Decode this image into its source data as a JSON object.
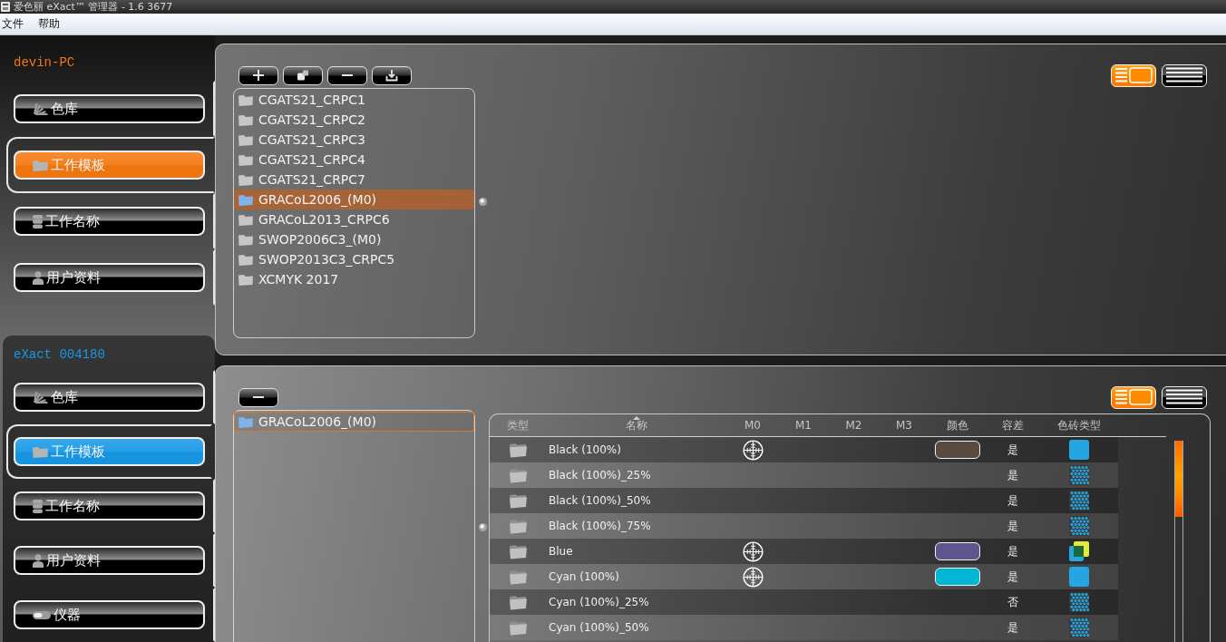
{
  "window": {
    "title": "爱色丽 eXact™ 管理器 - 1.6 3677"
  },
  "menu": [
    {
      "label": "文件"
    },
    {
      "label": "帮助"
    }
  ],
  "sidebar": {
    "sections": [
      {
        "label": "devin-PC",
        "color": "#f5780f",
        "items": [
          {
            "kind": "library",
            "label": "色库",
            "selected": false
          },
          {
            "kind": "template",
            "label": "工作模板",
            "selected": true
          },
          {
            "kind": "job",
            "label": "工作名称",
            "selected": false
          },
          {
            "kind": "user",
            "label": "用户资料",
            "selected": false
          }
        ]
      },
      {
        "label": "eXact 004180",
        "color": "#1799e6",
        "items": [
          {
            "kind": "library",
            "label": "色库",
            "selected": false
          },
          {
            "kind": "template",
            "label": "工作模板",
            "selected": true
          },
          {
            "kind": "job",
            "label": "工作名称",
            "selected": false
          },
          {
            "kind": "user",
            "label": "用户资料",
            "selected": false
          },
          {
            "kind": "instrument",
            "label": "仪器",
            "selected": false
          }
        ]
      }
    ]
  },
  "library_panel": {
    "toolbar": [
      {
        "kind": "add"
      },
      {
        "kind": "copy"
      },
      {
        "kind": "remove"
      },
      {
        "kind": "import"
      }
    ],
    "views": [
      {
        "kind": "split",
        "selected": true
      },
      {
        "kind": "list",
        "selected": false
      }
    ],
    "templates": [
      {
        "label": "CGATS21_CRPC1",
        "selected": false
      },
      {
        "label": "CGATS21_CRPC2",
        "selected": false
      },
      {
        "label": "CGATS21_CRPC3",
        "selected": false
      },
      {
        "label": "CGATS21_CRPC4",
        "selected": false
      },
      {
        "label": "CGATS21_CRPC7",
        "selected": false
      },
      {
        "label": "GRACoL2006_(M0)",
        "selected": true
      },
      {
        "label": "GRACoL2013_CRPC6",
        "selected": false
      },
      {
        "label": "SWOP2006C3_(M0)",
        "selected": false
      },
      {
        "label": "SWOP2013C3_CRPC5",
        "selected": false
      },
      {
        "label": "XCMYK 2017",
        "selected": false
      }
    ]
  },
  "detail_panel": {
    "toolbar": [
      {
        "kind": "remove"
      }
    ],
    "views": [
      {
        "kind": "split",
        "selected": true
      },
      {
        "kind": "list",
        "selected": false
      }
    ],
    "templates": [
      {
        "label": "GRACoL2006_(M0)",
        "selected": true
      }
    ],
    "table": {
      "columns": [
        {
          "label": "类型",
          "sorted": false
        },
        {
          "label": "名称",
          "sorted": true
        },
        {
          "label": "M0",
          "sorted": false
        },
        {
          "label": "M1",
          "sorted": false
        },
        {
          "label": "M2",
          "sorted": false
        },
        {
          "label": "M3",
          "sorted": false
        },
        {
          "label": "颜色",
          "sorted": false
        },
        {
          "label": "容差",
          "sorted": false
        },
        {
          "label": "色砖类型",
          "sorted": false
        }
      ],
      "rows": [
        {
          "name": "Black (100%)",
          "measured": [
            true,
            false,
            false,
            false
          ],
          "color": "#584a3e",
          "tolerance": "是",
          "patch": {
            "kind": "solid"
          }
        },
        {
          "name": "Black (100%)_25%",
          "measured": [
            false,
            false,
            false,
            false
          ],
          "tolerance": "是",
          "patch": {
            "kind": "screen"
          }
        },
        {
          "name": "Black (100%)_50%",
          "measured": [
            false,
            false,
            false,
            false
          ],
          "tolerance": "是",
          "patch": {
            "kind": "screen"
          }
        },
        {
          "name": "Black (100%)_75%",
          "measured": [
            false,
            false,
            false,
            false
          ],
          "tolerance": "是",
          "patch": {
            "kind": "screen"
          }
        },
        {
          "name": "Blue",
          "measured": [
            true,
            false,
            false,
            false
          ],
          "color": "#5e5490",
          "tolerance": "是",
          "patch": {
            "kind": "overprint"
          }
        },
        {
          "name": "Cyan (100%)",
          "measured": [
            true,
            false,
            false,
            false
          ],
          "color": "#00b6d2",
          "tolerance": "是",
          "patch": {
            "kind": "solid"
          }
        },
        {
          "name": "Cyan (100%)_25%",
          "measured": [
            false,
            false,
            false,
            false
          ],
          "tolerance": "否",
          "patch": {
            "kind": "screen"
          }
        },
        {
          "name": "Cyan (100%)_50%",
          "measured": [
            false,
            false,
            false,
            false
          ],
          "tolerance": "是",
          "patch": {
            "kind": "screen"
          }
        }
      ]
    }
  }
}
